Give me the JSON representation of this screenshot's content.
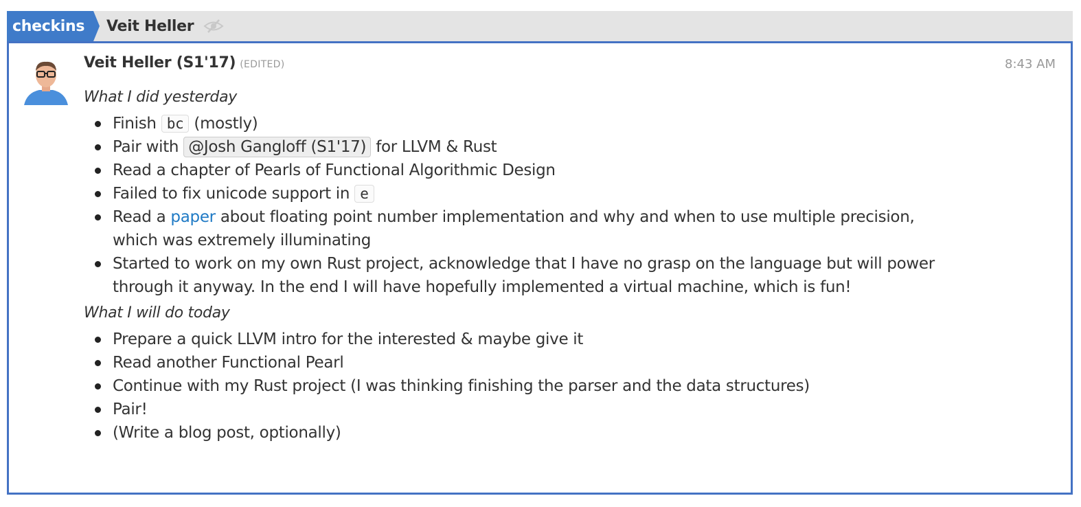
{
  "header": {
    "stream": "checkins",
    "topic": "Veit Heller",
    "mute_icon": "eye-slash-icon"
  },
  "message": {
    "sender": "Veit Heller (S1'17)",
    "edited": "(EDITED)",
    "time": "8:43 AM",
    "avatar_icon": "user-avatar",
    "yesterday_heading": "What I did yesterday",
    "yesterday": {
      "item1_a": "Finish",
      "item1_code": "bc",
      "item1_b": "(mostly)",
      "item2_a": "Pair with",
      "item2_mention": "@Josh Gangloff (S1'17)",
      "item2_b": "for LLVM & Rust",
      "item3": "Read a chapter of Pearls of Functional Algorithmic Design",
      "item4_a": "Failed to fix unicode support in",
      "item4_code": "e",
      "item5_a": "Read a",
      "item5_link": "paper",
      "item5_b": "about floating point number implementation and why and when to use multiple precision, which was extremely illuminating",
      "item6": "Started to work on my own Rust project, acknowledge that I have no grasp on the language but will power through it anyway. In the end I will have hopefully implemented a virtual machine, which is fun!"
    },
    "today_heading": "What I will do today",
    "today": [
      "Prepare a quick LLVM intro for the interested & maybe give it",
      "Read another Functional Pearl",
      "Continue with my Rust project (I was thinking finishing the parser and the data structures)",
      "Pair!",
      "(Write a blog post, optionally)"
    ]
  },
  "colors": {
    "stream": "#3f7bc9",
    "link": "#1f7ac5",
    "border": "#4472c4"
  }
}
